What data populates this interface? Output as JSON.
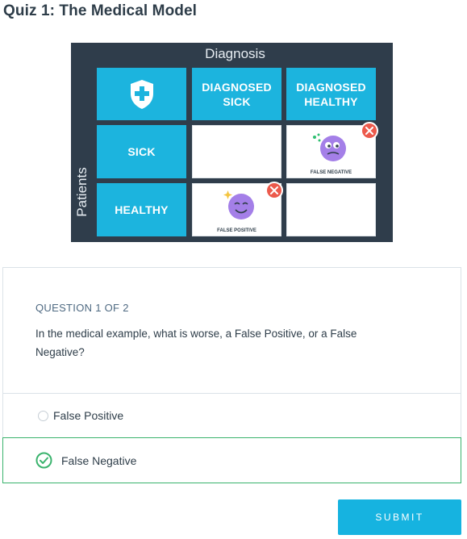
{
  "page": {
    "title": "Quiz 1: The Medical Model"
  },
  "figure": {
    "title": "Diagnosis",
    "side_label": "Patients",
    "header_col1": "DIAGNOSED\nSICK",
    "header_col2": "DIAGNOSED\nHEALTHY",
    "row1": "SICK",
    "row2": "HEALTHY",
    "false_negative": "FALSE NEGATIVE",
    "false_positive": "FALSE POSITIVE",
    "icons": [
      "shield-plus-icon",
      "sick-face-icon",
      "happy-face-icon",
      "x-icon"
    ],
    "colors": {
      "background": "#2f3d4b",
      "cell_blue": "#1cb4de",
      "face": "#a47fe8",
      "error": "#ec5a4c"
    }
  },
  "question": {
    "label": "QUESTION 1 OF 2",
    "text": "In the medical example, what is worse, a False Positive, or a False Negative?"
  },
  "options": [
    {
      "label": "False Positive",
      "selected": false
    },
    {
      "label": "False Negative",
      "selected": true
    }
  ],
  "submit_label": "SUBMIT",
  "colors": {
    "accent": "#16b3e0",
    "correct": "#3ab36d"
  }
}
